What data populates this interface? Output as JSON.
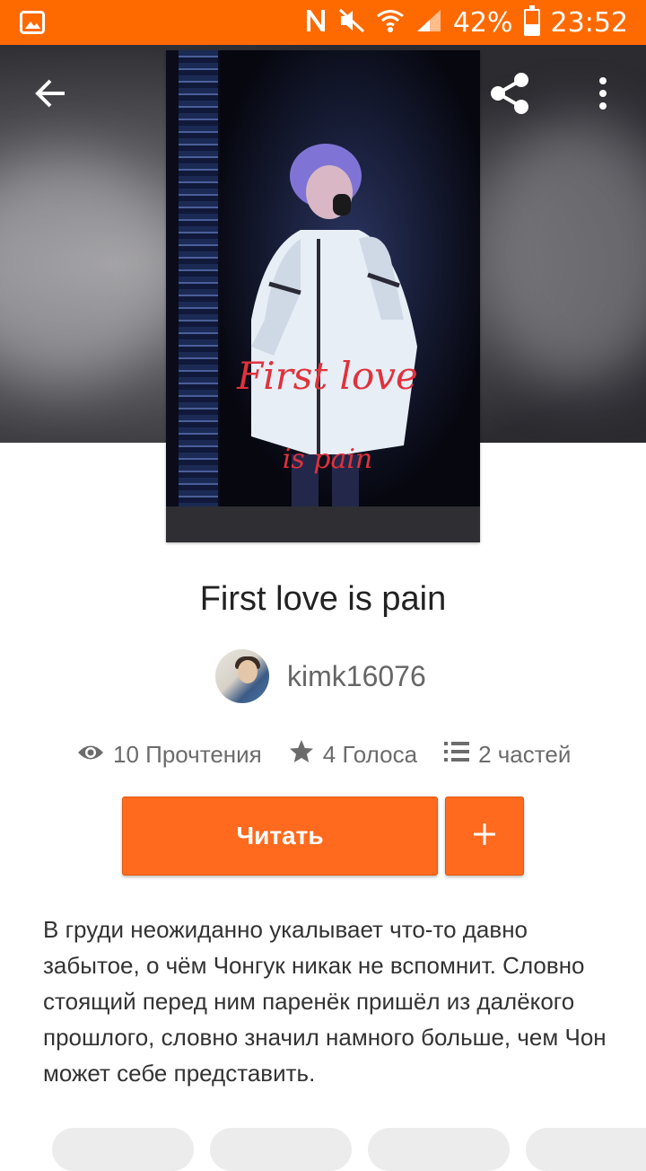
{
  "status_bar": {
    "battery_percent": "42%",
    "time": "23:52",
    "battery_level": 0.42,
    "icons": [
      "gallery-icon",
      "nfc-icon",
      "mute-icon",
      "wifi-icon",
      "signal-icon",
      "battery-icon"
    ]
  },
  "toolbar": {
    "back_icon": "arrow-left-icon",
    "share_icon": "share-icon",
    "more_icon": "more-vertical-icon"
  },
  "cover": {
    "title_line1": "First love",
    "title_line2": "is pain"
  },
  "story": {
    "title": "First love is pain",
    "author": "kimk16076",
    "stats": {
      "reads": "10 Прочтения",
      "votes": "4 Голоса",
      "parts": "2 частей"
    },
    "read_button": "Читать",
    "add_button_icon": "plus-icon",
    "description": "В груди неожиданно укалывает что-то давно забытое, о чём Чонгук никак не вспомнит. Словно стоящий перед ним паренёк пришёл из далёкого прошлого, словно значил намного больше, чем Чон может себе представить."
  },
  "colors": {
    "accent": "#ff6a00",
    "button": "#ff6a1e",
    "text_primary": "#222222",
    "text_secondary": "#6b6b6b"
  }
}
